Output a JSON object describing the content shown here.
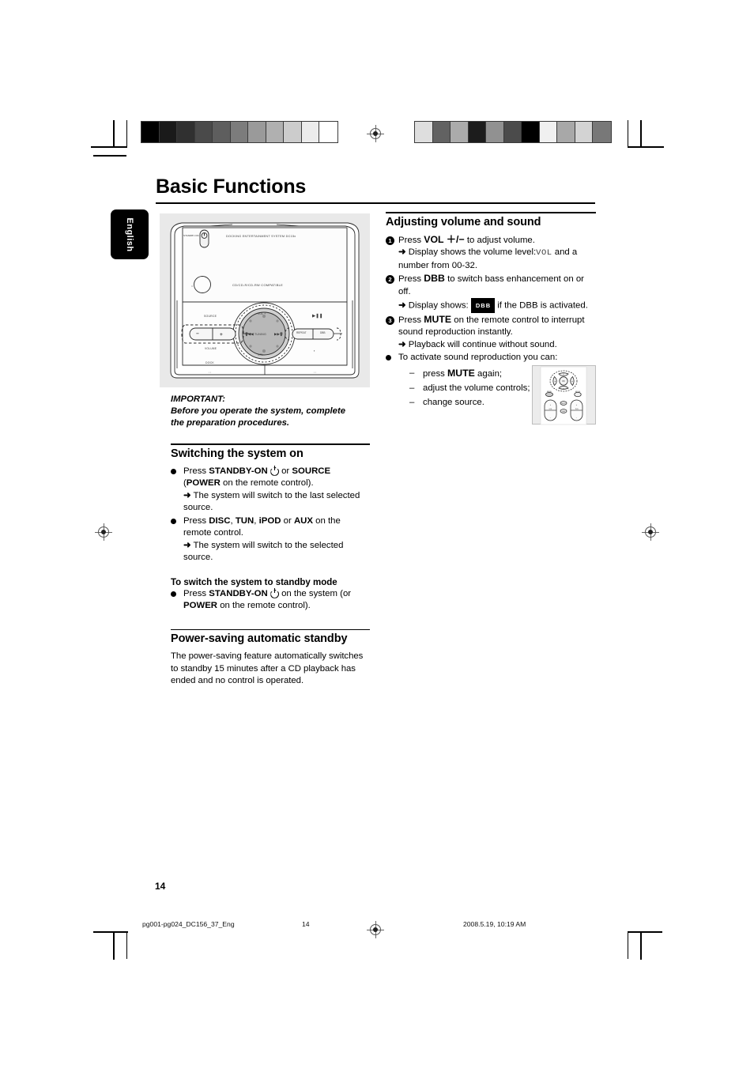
{
  "document": {
    "title": "Basic Functions",
    "language_tab": "English",
    "page_number": "14"
  },
  "product_image": {
    "brand_line": "DOCKING ENTERTAINMENT SYSTEM DC15x",
    "standby_label": "STANDBY-ON",
    "disc_label": "CD/CD-R/CD-RW COMPATIBLE",
    "controls": {
      "source": "SOURCE",
      "dock": "DOCK",
      "volume_minus": "−",
      "volume_plus": "+",
      "volume_group": "VOLUME",
      "vol_up": "VOL +",
      "vol_down": "VOL −",
      "tuning": "TUNING",
      "prev": "◀◀",
      "next": "▶▶",
      "play_pause": "▶Ⅱ",
      "repeat": "REPEAT",
      "dbb": "DBB"
    }
  },
  "left_column": {
    "important": {
      "heading": "IMPORTANT:",
      "line1": "Before you operate the system, complete",
      "line2": "the preparation procedures."
    },
    "switching_on": {
      "heading": "Switching the system on",
      "step1": {
        "marker": "bullet",
        "t1": "Press ",
        "b1": "STANDBY-ON",
        "t2": " ",
        "icon": "power-icon",
        "t3": " or ",
        "b2": "SOURCE",
        "t4": " (",
        "b3": "POWER",
        "t5": " on the remote control)."
      },
      "step1_result": "The system will switch to the last selected source.",
      "step2": {
        "marker": "bullet",
        "t1": "Press ",
        "b1": "DISC",
        "t2": ", ",
        "b2": "TUN",
        "t3": ", ",
        "b3": "iPOD",
        "t4": " or ",
        "b4": "AUX",
        "t5": " on the remote control."
      },
      "step2_result": "The system will switch to the selected source."
    },
    "standby_mode": {
      "subheading": "To switch the system to standby mode",
      "t1": "Press ",
      "b1": "STANDBY-ON",
      "t2": " ",
      "icon": "power-icon",
      "t3": " on the system (or ",
      "b2": "POWER",
      "t4": " on the  remote control)."
    },
    "power_saving": {
      "heading": "Power-saving automatic standby",
      "body": "The power-saving feature automatically switches to standby 15 minutes after a CD playback has ended and no control is operated."
    }
  },
  "right_column": {
    "heading": "Adjusting volume and sound",
    "steps": [
      {
        "number": "1",
        "t1": "Press  ",
        "b1": "VOL",
        "t2": " ＋/−",
        "t3": "   to adjust volume."
      },
      {
        "number": "2",
        "t1": "Press ",
        "b1": "DBB",
        "t2": " to switch bass enhancement on or off."
      },
      {
        "number": "3",
        "t1": "Press ",
        "b1": "MUTE",
        "t2": " on the remote control to interrupt sound reproduction instantly."
      }
    ],
    "result1_a": "Display shows the volume level:",
    "result1_lcd": "VOL",
    "result1_b": "and a number from 00-32.",
    "result2_a": "Display shows:",
    "result2_badge": "DBB",
    "result2_b": "if the DBB is activated.",
    "result3": "Playback will continue without sound.",
    "activate": {
      "t1": "To activate sound reproduction you can:",
      "items": [
        {
          "t1": "press ",
          "b1": "MUTE",
          "t2": " again;"
        },
        {
          "t1": "adjust the volume controls;",
          "b1": "",
          "t2": ""
        },
        {
          "t1": "change source.",
          "b1": "",
          "t2": ""
        }
      ]
    }
  },
  "footer": {
    "file_name": "pg001-pg024_DC156_37_Eng",
    "page": "14",
    "timestamp": "2008.5.19, 10:19 AM"
  },
  "swatches": {
    "left": [
      "#000000",
      "#1a1a1a",
      "#303030",
      "#4a4a4a",
      "#5e5e5e",
      "#7c7c7c",
      "#9a9a9a",
      "#b0b0b0",
      "#cccccc",
      "#ececec",
      "#ffffff"
    ],
    "right": [
      "#dedede",
      "#626262",
      "#ababab",
      "#1c1c1c",
      "#919191",
      "#4b4b4b",
      "#000000",
      "#f0f0f0",
      "#a8a8a8",
      "#d3d3d3",
      "#787878"
    ]
  }
}
